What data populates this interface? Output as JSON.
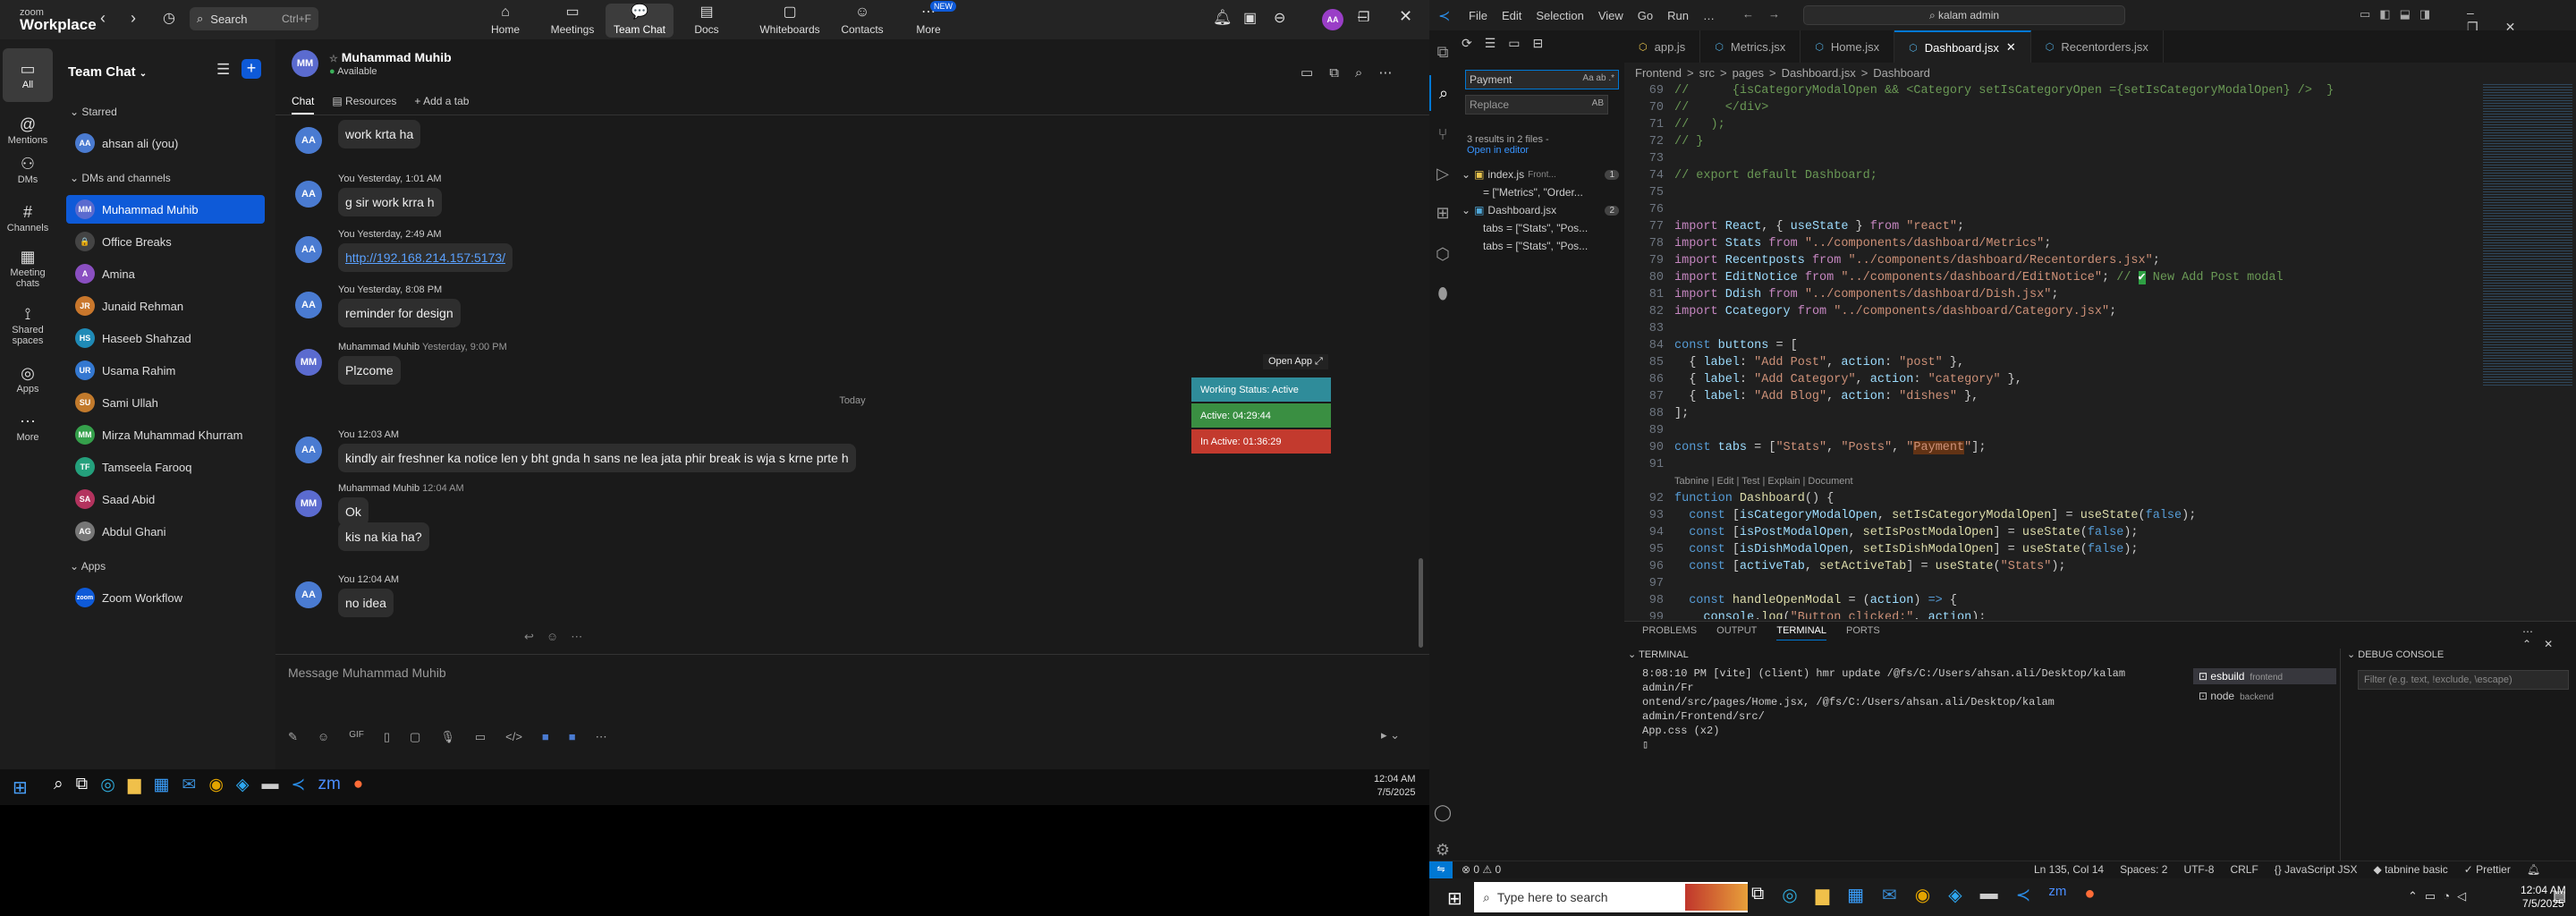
{
  "zoom": {
    "logo_line1": "zoom",
    "logo_line2": "Workplace",
    "search": {
      "label": "Search",
      "shortcut": "Ctrl+F"
    },
    "tabs": [
      {
        "label": "Home",
        "icon": "home-icon"
      },
      {
        "label": "Meetings",
        "icon": "video-icon"
      },
      {
        "label": "Team Chat",
        "icon": "chat-icon"
      },
      {
        "label": "Docs",
        "icon": "doc-icon"
      },
      {
        "label": "Whiteboards",
        "icon": "whiteboard-icon"
      },
      {
        "label": "Contacts",
        "icon": "contacts-icon"
      },
      {
        "label": "More",
        "icon": "more-icon",
        "badge": "NEW"
      }
    ],
    "user_initials": "AA",
    "sidebar": [
      {
        "label": "All"
      },
      {
        "label": "Mentions"
      },
      {
        "label": "DMs"
      },
      {
        "label": "Channels"
      },
      {
        "label": "Meeting chats"
      },
      {
        "label": "Shared spaces"
      },
      {
        "label": "Apps"
      },
      {
        "label": "More"
      }
    ],
    "list": {
      "title": "Team Chat",
      "starred_label": "Starred",
      "starred": [
        {
          "initials": "AA",
          "name": "ahsan ali (you)",
          "color": "#4a7bd1"
        }
      ],
      "dm_label": "DMs and channels",
      "items": [
        {
          "initials": "MM",
          "name": "Muhammad Muhib",
          "color": "#5b6bcf",
          "active": true
        },
        {
          "initials": "🔒",
          "name": "Office Breaks",
          "color": "#444"
        },
        {
          "initials": "A",
          "name": "Amina",
          "color": "#8a4fc1"
        },
        {
          "initials": "JR",
          "name": "Junaid Rehman",
          "color": "#c9772c"
        },
        {
          "initials": "HS",
          "name": "Haseeb Shahzad",
          "color": "#1f8ab6"
        },
        {
          "initials": "UR",
          "name": "Usama Rahim",
          "color": "#3478d1"
        },
        {
          "initials": "SU",
          "name": "Sami Ullah",
          "color": "#c27a2c"
        },
        {
          "initials": "MM",
          "name": "Mirza Muhammad Khurram",
          "color": "#35a04b"
        },
        {
          "initials": "TF",
          "name": "Tamseela Farooq",
          "color": "#24a07c"
        },
        {
          "initials": "SA",
          "name": "Saad Abid",
          "color": "#b3335e"
        },
        {
          "initials": "AG",
          "name": "Abdul Ghani",
          "color": "#777"
        }
      ],
      "apps_label": "Apps",
      "apps": [
        {
          "initials": "zoom",
          "name": "Zoom Workflow",
          "color": "#0e5ad8"
        }
      ]
    },
    "chat": {
      "name": "Muhammad Muhib",
      "status": "Available",
      "initials": "MM",
      "tabs": [
        "Chat",
        "Resources",
        "Add a tab"
      ],
      "messages": [
        {
          "who": "AA",
          "meta": "",
          "text": "work krta ha",
          "color": "#4a7bd1"
        },
        {
          "who": "AA",
          "meta": "You Yesterday, 1:01 AM",
          "text": "g sir work krra h",
          "color": "#4a7bd1"
        },
        {
          "who": "AA",
          "meta": "You Yesterday, 2:49 AM",
          "text": "http://192.168.214.157:5173/",
          "link": true,
          "color": "#4a7bd1"
        },
        {
          "who": "AA",
          "meta": "You Yesterday, 8:08 PM",
          "text": "reminder for design",
          "color": "#4a7bd1"
        },
        {
          "who": "MM",
          "meta": "Muhammad Muhib",
          "meta2": "Yesterday, 9:00 PM",
          "text": "Plzcome",
          "color": "#5b6bcf"
        },
        {
          "who": "AA",
          "meta": "You 12:03 AM",
          "text": "kindly air freshner ka notice len y bht gnda h  sans ne lea jata phir break is wja s krne prte h",
          "color": "#4a7bd1"
        },
        {
          "who": "MM",
          "meta": "Muhammad Muhib",
          "meta2": "12:04 AM",
          "text": "Ok",
          "color": "#5b6bcf"
        },
        {
          "who": "",
          "meta": "",
          "text": "kis na kia ha?",
          "color": "#5b6bcf"
        },
        {
          "who": "AA",
          "meta": "You 12:04 AM",
          "text": "no idea",
          "color": "#4a7bd1"
        }
      ],
      "today_label": "Today",
      "open_app": "Open App",
      "working": [
        {
          "label": "Working Status: Active",
          "color": "#2f8c9a"
        },
        {
          "label": "Active: 04:29:44",
          "color": "#3a8f42"
        },
        {
          "label": "In Active: 01:36:29",
          "color": "#c33a2e"
        }
      ],
      "composer_placeholder": "Message Muhammad Muhib"
    },
    "taskbar": {
      "time": "12:04 AM",
      "date": "7/5/2025"
    }
  },
  "vscode": {
    "menu": [
      "File",
      "Edit",
      "Selection",
      "View",
      "Go",
      "Run",
      "…"
    ],
    "search_box": "kalam admin",
    "find": {
      "search": "Payment",
      "replace": "Replace",
      "results": "3 results in 2 files - ",
      "open_editor": "Open in editor",
      "files": [
        {
          "name": "index.js",
          "path": "Front...",
          "count": "1",
          "matches": [
            "= [\"Metrics\", \"Order..."
          ]
        },
        {
          "name": "Dashboard.jsx",
          "path": "",
          "count": "2",
          "matches": [
            "tabs = [\"Stats\", \"Pos...",
            "tabs = [\"Stats\", \"Pos..."
          ]
        }
      ]
    },
    "tabs": [
      {
        "label": "app.js",
        "color": "#e8c44d"
      },
      {
        "label": "Metrics.jsx",
        "color": "#4fa7d8"
      },
      {
        "label": "Home.jsx",
        "color": "#4fa7d8"
      },
      {
        "label": "Dashboard.jsx",
        "color": "#4fa7d8",
        "active": true
      },
      {
        "label": "Recentorders.jsx",
        "color": "#4fa7d8"
      }
    ],
    "breadcrumb": [
      "Frontend",
      ">",
      "src",
      ">",
      "pages",
      ">",
      "Dashboard.jsx",
      ">",
      "Dashboard"
    ],
    "code": [
      {
        "n": "69",
        "html": "<span class='cmt'>//      {isCategoryModalOpen &amp;&amp; &lt;Category setIsCategoryOpen ={setIsCategoryModalOpen} /&gt;  }</span>"
      },
      {
        "n": "70",
        "html": "<span class='cmt'>//     &lt;/div&gt;</span>"
      },
      {
        "n": "71",
        "html": "<span class='cmt'>//   );</span>"
      },
      {
        "n": "72",
        "html": "<span class='cmt'>// }</span>"
      },
      {
        "n": "73",
        "html": ""
      },
      {
        "n": "74",
        "html": "<span class='cmt'>// export default Dashboard;</span>"
      },
      {
        "n": "75",
        "html": ""
      },
      {
        "n": "76",
        "html": ""
      },
      {
        "n": "77",
        "html": "<span class='ctl'>import</span> <span class='vr'>React</span>, { <span class='vr'>useState</span> } <span class='ctl'>from</span> <span class='str'>\"react\"</span>;"
      },
      {
        "n": "78",
        "html": "<span class='ctl'>import</span> <span class='vr'>Stats</span> <span class='ctl'>from</span> <span class='str'>\"../components/dashboard/Metrics\"</span>;"
      },
      {
        "n": "79",
        "html": "<span class='ctl'>import</span> <span class='vr'>Recentposts</span> <span class='ctl'>from</span> <span class='str'>\"../components/dashboard/Recentorders.jsx\"</span>;"
      },
      {
        "n": "80",
        "html": "<span class='ctl'>import</span> <span class='vr'>EditNotice</span> <span class='ctl'>from</span> <span class='str'>\"../components/dashboard/EditNotice\"</span>; <span class='cmt'>// <span style='background:#2ea043;color:#fff'>✔</span> New Add Post modal</span>"
      },
      {
        "n": "81",
        "html": "<span class='ctl'>import</span> <span class='vr'>Ddish</span> <span class='ctl'>from</span> <span class='str'>\"../components/dashboard/Dish.jsx\"</span>;"
      },
      {
        "n": "82",
        "html": "<span class='ctl'>import</span> <span class='vr'>Ccategory</span> <span class='ctl'>from</span> <span class='str'>\"../components/dashboard/Category.jsx\"</span>;"
      },
      {
        "n": "83",
        "html": ""
      },
      {
        "n": "84",
        "html": "<span class='kw'>const</span> <span class='vr'>buttons</span> = ["
      },
      {
        "n": "85",
        "html": "  { <span class='vr'>label</span>: <span class='str'>\"Add Post\"</span>, <span class='vr'>action</span>: <span class='str'>\"post\"</span> },"
      },
      {
        "n": "86",
        "html": "  { <span class='vr'>label</span>: <span class='str'>\"Add Category\"</span>, <span class='vr'>action</span>: <span class='str'>\"category\"</span> },"
      },
      {
        "n": "87",
        "html": "  { <span class='vr'>label</span>: <span class='str'>\"Add Blog\"</span>, <span class='vr'>action</span>: <span class='str'>\"dishes\"</span> },"
      },
      {
        "n": "88",
        "html": "];"
      },
      {
        "n": "89",
        "html": ""
      },
      {
        "n": "90",
        "html": "<span class='kw'>const</span> <span class='vr'>tabs</span> = [<span class='str'>\"Stats\"</span>, <span class='str'>\"Posts\"</span>, <span class='str'>\"<span style='background:#623315'>Payment</span>\"</span>];"
      },
      {
        "n": "91",
        "html": ""
      },
      {
        "n": "",
        "html": "<span style='color:#999;font-family:Liberation Sans,sans-serif;font-size:11px'>Tabnine | Edit | Test | Explain | Document</span>"
      },
      {
        "n": "92",
        "html": "<span class='kw'>function</span> <span class='fn'>Dashboard</span>() {"
      },
      {
        "n": "93",
        "html": "  <span class='kw'>const</span> [<span class='vr'>isCategoryModalOpen</span>, <span class='fn'>setIsCategoryModalOpen</span>] = <span class='fn'>useState</span>(<span class='kw'>false</span>);"
      },
      {
        "n": "94",
        "html": "  <span class='kw'>const</span> [<span class='vr'>isPostModalOpen</span>, <span class='fn'>setIsPostModalOpen</span>] = <span class='fn'>useState</span>(<span class='kw'>false</span>);"
      },
      {
        "n": "95",
        "html": "  <span class='kw'>const</span> [<span class='vr'>isDishModalOpen</span>, <span class='fn'>setIsDishModalOpen</span>] = <span class='fn'>useState</span>(<span class='kw'>false</span>);"
      },
      {
        "n": "96",
        "html": "  <span class='kw'>const</span> [<span class='vr'>activeTab</span>, <span class='fn'>setActiveTab</span>] = <span class='fn'>useState</span>(<span class='str'>\"Stats\"</span>);"
      },
      {
        "n": "97",
        "html": ""
      },
      {
        "n": "98",
        "html": "  <span class='kw'>const</span> <span class='fn'>handleOpenModal</span> = (<span class='vr'>action</span>) <span class='kw'>=&gt;</span> {"
      },
      {
        "n": "99",
        "html": "    <span class='vr'>console</span>.<span class='fn'>log</span>(<span class='str'>\"Button clicked:\"</span>, <span class='vr'>action</span>);"
      }
    ],
    "panel_tabs": [
      "PROBLEMS",
      "OUTPUT",
      "TERMINAL",
      "PORTS"
    ],
    "terminal_title": "TERMINAL",
    "terminal_lines": [
      "8:08:10 PM [vite] (client) hmr update /@fs/C:/Users/ahsan.ali/Desktop/kalam admin/Fr",
      "ontend/src/pages/Home.jsx, /@fs/C:/Users/ahsan.ali/Desktop/kalam admin/Frontend/src/",
      "App.css (x2)"
    ],
    "terminals": [
      {
        "name": "esbuild",
        "sub": "frontend"
      },
      {
        "name": "node",
        "sub": "backend"
      }
    ],
    "debug_title": "DEBUG CONSOLE",
    "debug_placeholder": "Filter (e.g. text, !exclude, \\escape)",
    "status": {
      "errors": "⊗ 0  ⚠ 0",
      "pos": "Ln 135, Col 14",
      "spaces": "Spaces: 2",
      "enc": "UTF-8",
      "eol": "CRLF",
      "lang": "{} JavaScript JSX",
      "tabnine": "tabnine basic",
      "prettier": "✓ Prettier"
    }
  },
  "windows": {
    "search_placeholder": "Type here to search",
    "time": "12:04 AM",
    "date": "7/5/2025"
  }
}
